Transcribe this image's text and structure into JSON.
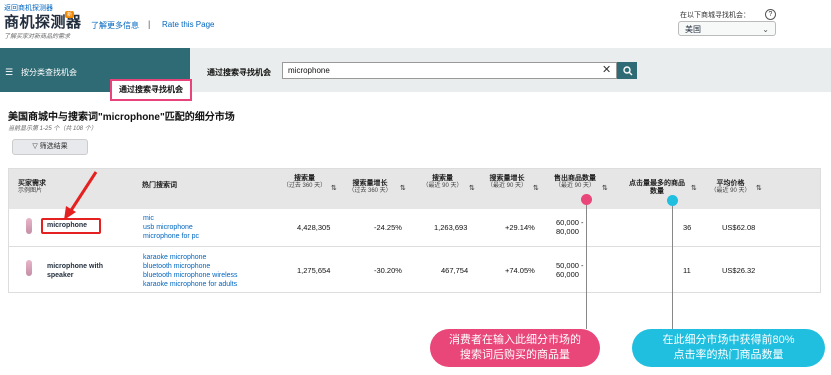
{
  "header": {
    "back_link": "返回商机探测器",
    "logo": "商机探测器",
    "logo_badge": "新",
    "subtitle": "了解买家对新商品的需求",
    "learn_more": "了解更多信息",
    "separator": "|",
    "rate_page": "Rate this Page",
    "market_label": "在以下商城寻找机会：",
    "market_value": "美国"
  },
  "nav": {
    "category_tab": "按分类查找机会",
    "search_label": "通过搜索寻找机会",
    "search_value": "microphone",
    "search_tab": "通过搜索寻找机会"
  },
  "results": {
    "title": "美国商城中与搜索词\"microphone\"匹配的细分市场",
    "count": "当前显示第 1-25 个（共 108 个）",
    "filter_button": "筛选结果"
  },
  "table": {
    "columns": {
      "demand": {
        "label": "买家需求",
        "sub": "示例图片"
      },
      "top_terms": {
        "label": "热门搜索词"
      },
      "search_vol": {
        "label": "搜索量",
        "sub": "（过去 360 天）"
      },
      "search_growth": {
        "label": "搜索量增长",
        "sub": "（过去 360 天）"
      },
      "search_vol_90": {
        "label": "搜索量",
        "sub": "（最近 90 天）"
      },
      "search_growth_90": {
        "label": "搜索量增长",
        "sub": "（最近 90 天）"
      },
      "units_sold": {
        "label": "售出商品数量",
        "sub": "（最近 90 天）"
      },
      "most_clicked": {
        "label": "点击量最多的商品数量"
      },
      "avg_price": {
        "label": "平均价格",
        "sub": "（最近 90 天）"
      }
    },
    "rows": [
      {
        "demand": "microphone",
        "terms": [
          "mic",
          "usb microphone",
          "microphone for pc"
        ],
        "search_vol": "4,428,305",
        "search_growth": "-24.25%",
        "search_vol_90": "1,263,693",
        "search_growth_90": "+29.14%",
        "units_sold_1": "60,000 -",
        "units_sold_2": "80,000",
        "most_clicked": "36",
        "avg_price": "US$62.08"
      },
      {
        "demand": "microphone with speaker",
        "terms": [
          "karaoke microphone",
          "bluetooth microphone",
          "bluetooth microphone wireless",
          "karaoke microphone for adults"
        ],
        "search_vol": "1,275,654",
        "search_growth": "-30.20%",
        "search_vol_90": "467,754",
        "search_growth_90": "+74.05%",
        "units_sold_1": "50,000 -",
        "units_sold_2": "60,000",
        "most_clicked": "11",
        "avg_price": "US$26.32"
      }
    ]
  },
  "annotations": {
    "pink_line1": "消费者在输入此细分市场的",
    "pink_line2": "搜索词后购买的商品量",
    "cyan_line1": "在此细分市场中获得前80%",
    "cyan_line2": "点击率的热门商品数量",
    "pink_color": "#e9467a",
    "cyan_color": "#20bfe0"
  },
  "icons": [
    "hamburger-icon",
    "clear-icon",
    "search-icon",
    "chevron-down-icon",
    "help-icon",
    "filter-icon",
    "sort-icon",
    "arrow-annotation-icon"
  ]
}
